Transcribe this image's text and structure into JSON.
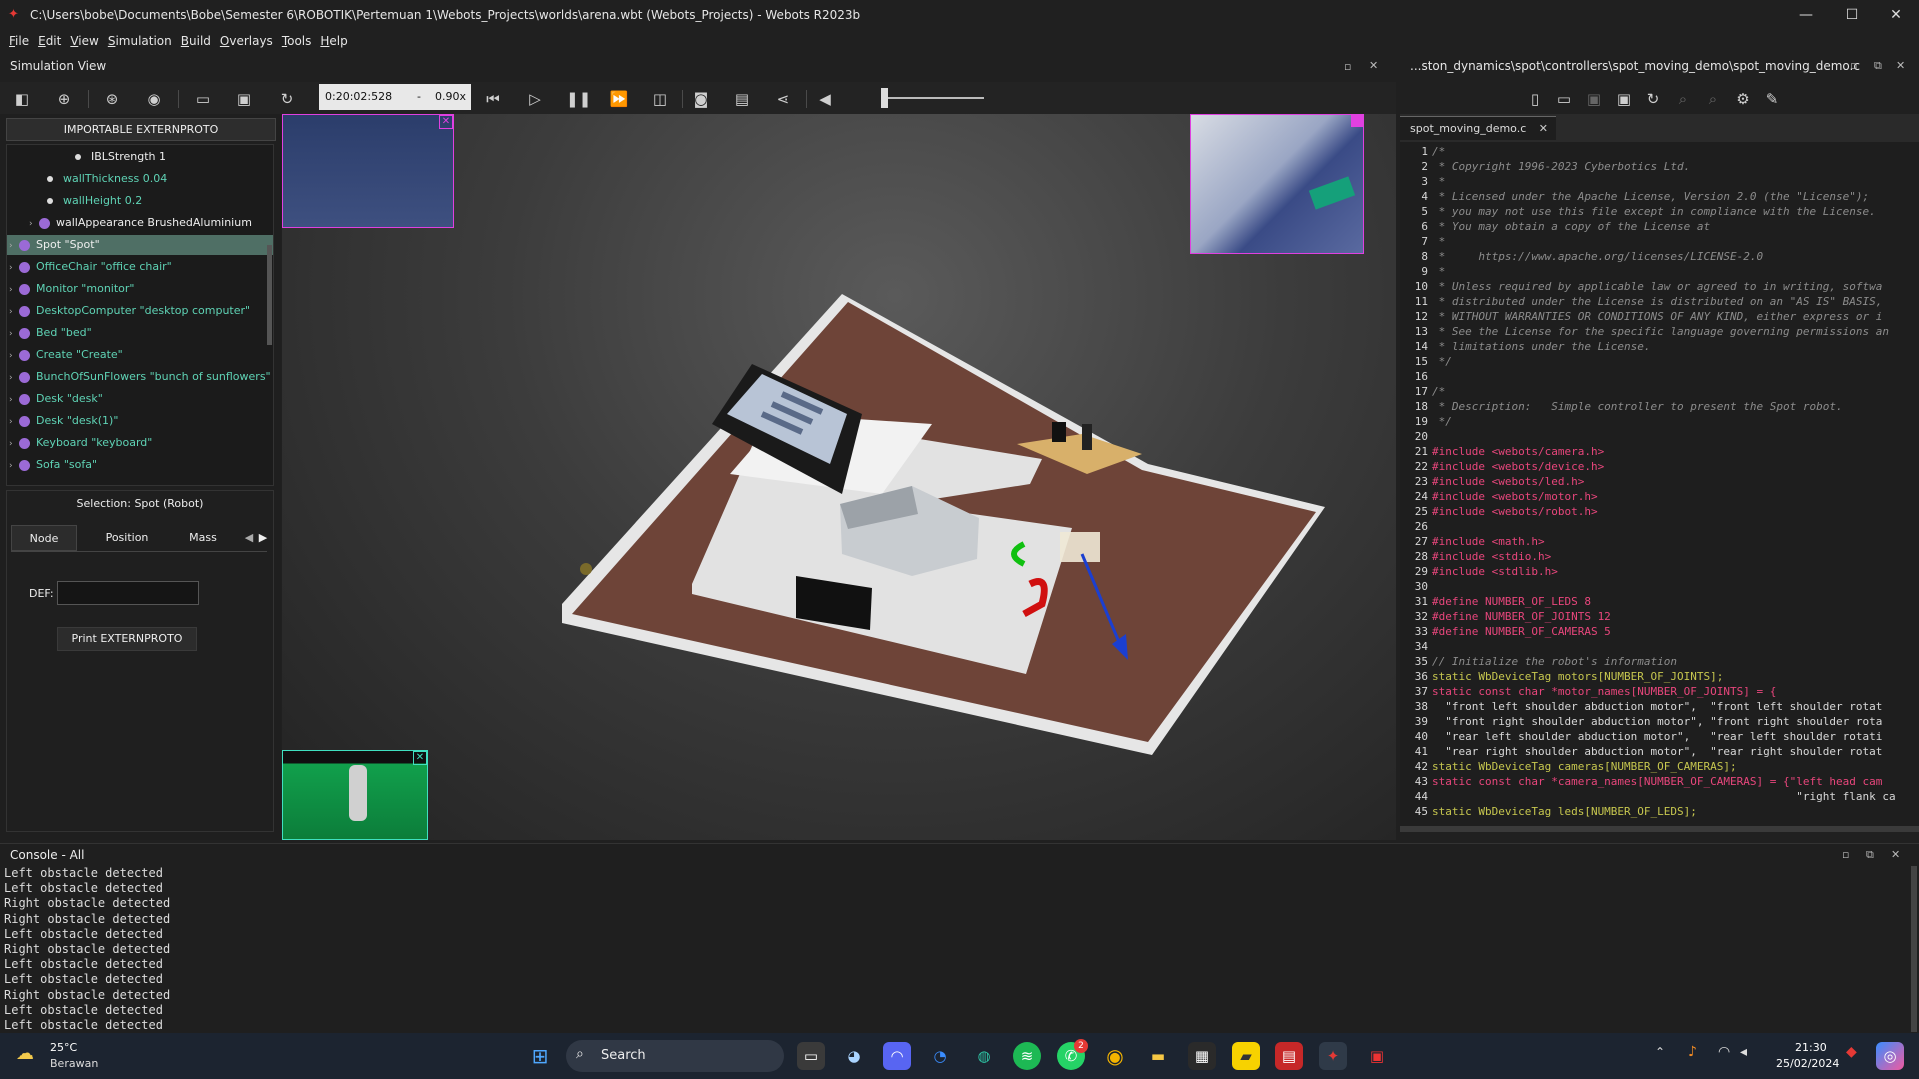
{
  "window": {
    "title": "C:\\Users\\bobe\\Documents\\Bobe\\Semester 6\\ROBOTIK\\Pertemuan 1\\Webots_Projects\\worlds\\arena.wbt (Webots_Projects) - Webots R2023b"
  },
  "menu": [
    "File",
    "Edit",
    "View",
    "Simulation",
    "Build",
    "Overlays",
    "Tools",
    "Help"
  ],
  "sim_view": {
    "title": "Simulation View",
    "time": "0:20:02:528",
    "speed_sep": "-",
    "speed": "0.90x"
  },
  "scene_tree": {
    "import_button": "IMPORTABLE EXTERNPROTO",
    "rows": [
      {
        "label": "IBLStrength 1",
        "kind": "field"
      },
      {
        "label": "wallThickness 0.04",
        "kind": "field"
      },
      {
        "label": "wallHeight 0.2",
        "kind": "field"
      },
      {
        "label": "wallAppearance BrushedAluminium",
        "kind": "node"
      },
      {
        "label": "Spot \"Spot\"",
        "kind": "node-selected"
      },
      {
        "label": "OfficeChair \"office chair\"",
        "kind": "node"
      },
      {
        "label": "Monitor \"monitor\"",
        "kind": "node"
      },
      {
        "label": "DesktopComputer \"desktop computer\"",
        "kind": "node"
      },
      {
        "label": "Bed \"bed\"",
        "kind": "node"
      },
      {
        "label": "Create \"Create\"",
        "kind": "node"
      },
      {
        "label": "BunchOfSunFlowers \"bunch of sunflowers\"",
        "kind": "node"
      },
      {
        "label": "Desk \"desk\"",
        "kind": "node"
      },
      {
        "label": "Desk \"desk(1)\"",
        "kind": "node"
      },
      {
        "label": "Keyboard \"keyboard\"",
        "kind": "node"
      },
      {
        "label": "Sofa \"sofa\"",
        "kind": "node"
      }
    ]
  },
  "properties": {
    "selection": "Selection: Spot (Robot)",
    "tabs": [
      "Node",
      "Position",
      "Mass"
    ],
    "def_label": "DEF:",
    "def_value": "",
    "print_button": "Print EXTERNPROTO"
  },
  "editor": {
    "header_path": "...ston_dynamics\\spot\\controllers\\spot_moving_demo\\spot_moving_demo.c",
    "tab": "spot_moving_demo.c",
    "lines": [
      {
        "n": "1",
        "t": "/*",
        "c": "cm"
      },
      {
        "n": "2",
        "t": " * Copyright 1996-2023 Cyberbotics Ltd.",
        "c": "cm"
      },
      {
        "n": "3",
        "t": " *",
        "c": "cm"
      },
      {
        "n": "4",
        "t": " * Licensed under the Apache License, Version 2.0 (the \"License\");",
        "c": "cm"
      },
      {
        "n": "5",
        "t": " * you may not use this file except in compliance with the License.",
        "c": "cm"
      },
      {
        "n": "6",
        "t": " * You may obtain a copy of the License at",
        "c": "cm"
      },
      {
        "n": "7",
        "t": " *",
        "c": "cm"
      },
      {
        "n": "8",
        "t": " *     https://www.apache.org/licenses/LICENSE-2.0",
        "c": "cm"
      },
      {
        "n": "9",
        "t": " *",
        "c": "cm"
      },
      {
        "n": "10",
        "t": " * Unless required by applicable law or agreed to in writing, softwa",
        "c": "cm"
      },
      {
        "n": "11",
        "t": " * distributed under the License is distributed on an \"AS IS\" BASIS,",
        "c": "cm"
      },
      {
        "n": "12",
        "t": " * WITHOUT WARRANTIES OR CONDITIONS OF ANY KIND, either express or i",
        "c": "cm"
      },
      {
        "n": "13",
        "t": " * See the License for the specific language governing permissions an",
        "c": "cm"
      },
      {
        "n": "14",
        "t": " * limitations under the License.",
        "c": "cm"
      },
      {
        "n": "15",
        "t": " */",
        "c": "cm"
      },
      {
        "n": "16",
        "t": "",
        "c": "st"
      },
      {
        "n": "17",
        "t": "/*",
        "c": "cm"
      },
      {
        "n": "18",
        "t": " * Description:   Simple controller to present the Spot robot.",
        "c": "cm"
      },
      {
        "n": "19",
        "t": " */",
        "c": "cm"
      },
      {
        "n": "20",
        "t": "",
        "c": "st"
      },
      {
        "n": "21",
        "t": "#include <webots/camera.h>",
        "c": "pp"
      },
      {
        "n": "22",
        "t": "#include <webots/device.h>",
        "c": "pp"
      },
      {
        "n": "23",
        "t": "#include <webots/led.h>",
        "c": "pp"
      },
      {
        "n": "24",
        "t": "#include <webots/motor.h>",
        "c": "pp"
      },
      {
        "n": "25",
        "t": "#include <webots/robot.h>",
        "c": "pp"
      },
      {
        "n": "26",
        "t": "",
        "c": "st"
      },
      {
        "n": "27",
        "t": "#include <math.h>",
        "c": "pp"
      },
      {
        "n": "28",
        "t": "#include <stdio.h>",
        "c": "pp"
      },
      {
        "n": "29",
        "t": "#include <stdlib.h>",
        "c": "pp"
      },
      {
        "n": "30",
        "t": "",
        "c": "st"
      },
      {
        "n": "31",
        "t": "#define NUMBER_OF_LEDS 8",
        "c": "pp"
      },
      {
        "n": "32",
        "t": "#define NUMBER_OF_JOINTS 12",
        "c": "pp"
      },
      {
        "n": "33",
        "t": "#define NUMBER_OF_CAMERAS 5",
        "c": "pp"
      },
      {
        "n": "34",
        "t": "",
        "c": "st"
      },
      {
        "n": "35",
        "t": "// Initialize the robot's information",
        "c": "cm"
      },
      {
        "n": "36",
        "t": "static WbDeviceTag motors[NUMBER_OF_JOINTS];",
        "c": "ty"
      },
      {
        "n": "37",
        "t": "static const char *motor_names[NUMBER_OF_JOINTS] = {",
        "c": "kw"
      },
      {
        "n": "38",
        "t": "  \"front left shoulder abduction motor\",  \"front left shoulder rotat",
        "c": "st"
      },
      {
        "n": "39",
        "t": "  \"front right shoulder abduction motor\", \"front right shoulder rota",
        "c": "st"
      },
      {
        "n": "40",
        "t": "  \"rear left shoulder abduction motor\",   \"rear left shoulder rotati",
        "c": "st"
      },
      {
        "n": "41",
        "t": "  \"rear right shoulder abduction motor\",  \"rear right shoulder rotat",
        "c": "st"
      },
      {
        "n": "42",
        "t": "static WbDeviceTag cameras[NUMBER_OF_CAMERAS];",
        "c": "ty"
      },
      {
        "n": "43",
        "t": "static const char *camera_names[NUMBER_OF_CAMERAS] = {\"left head cam",
        "c": "kw"
      },
      {
        "n": "44",
        "t": "                                                       \"right flank ca",
        "c": "st"
      },
      {
        "n": "45",
        "t": "static WbDeviceTag leds[NUMBER_OF_LEDS];",
        "c": "ty"
      }
    ]
  },
  "console": {
    "title": "Console - All",
    "lines": [
      "Left obstacle detected",
      "Left obstacle detected",
      "Right obstacle detected",
      "Right obstacle detected",
      "Left obstacle detected",
      "Right obstacle detected",
      "Left obstacle detected",
      "Left obstacle detected",
      "Right obstacle detected",
      "Left obstacle detected",
      "Left obstacle detected"
    ]
  },
  "taskbar": {
    "weather_temp": "25°C",
    "weather_desc": "Berawan",
    "search": "Search",
    "time": "21:30",
    "date": "25/02/2024",
    "discord_badge": "",
    "whatsapp_badge": "2"
  }
}
